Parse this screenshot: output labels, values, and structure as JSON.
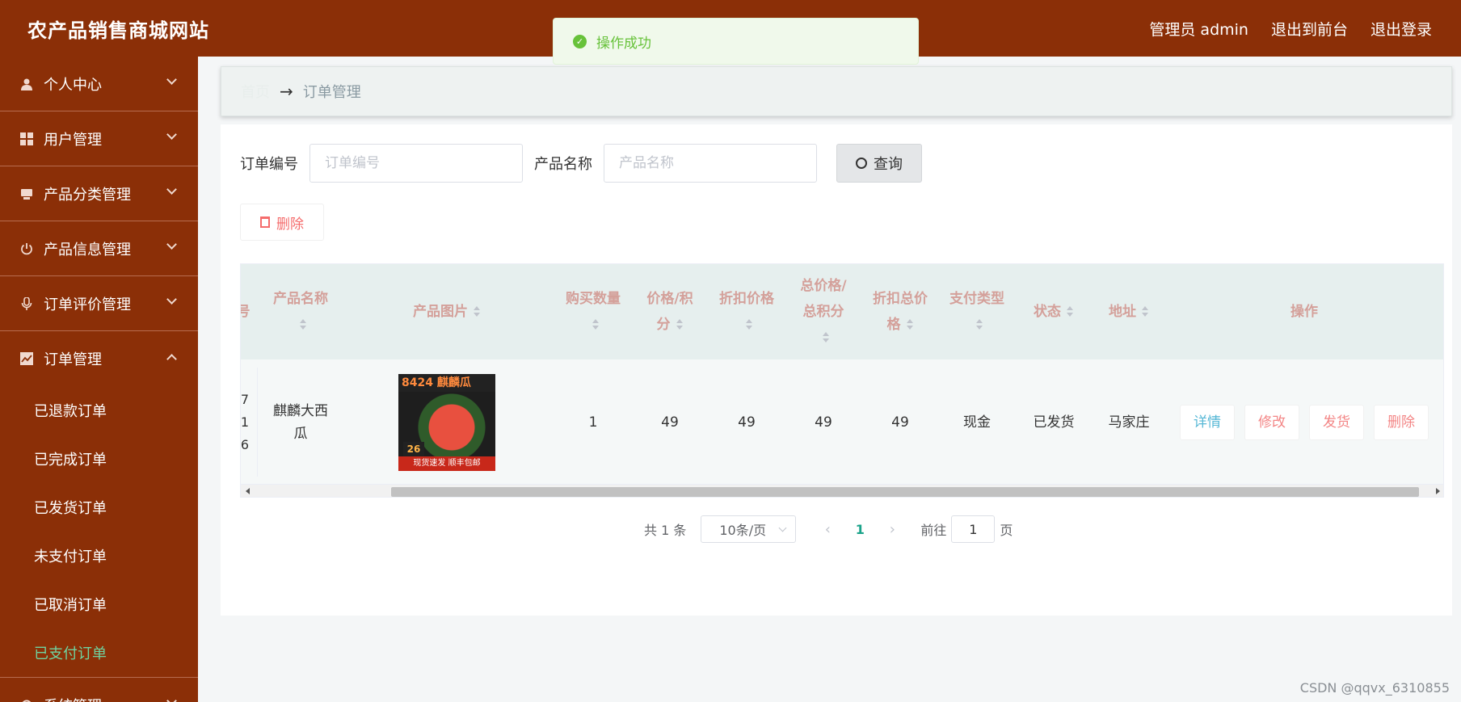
{
  "header": {
    "brand": "农产品销售商城网站",
    "admin_label": "管理员 admin",
    "front_label": "退出到前台",
    "logout_label": "退出登录"
  },
  "toast": {
    "message": "操作成功"
  },
  "sidebar": {
    "items": [
      {
        "label": "个人中心",
        "icon": "user-icon"
      },
      {
        "label": "用户管理",
        "icon": "grid-icon"
      },
      {
        "label": "产品分类管理",
        "icon": "box-icon"
      },
      {
        "label": "产品信息管理",
        "icon": "power-icon"
      },
      {
        "label": "订单评价管理",
        "icon": "microphone-icon"
      },
      {
        "label": "订单管理",
        "icon": "chart-icon"
      }
    ],
    "submenu": [
      {
        "label": "已退款订单"
      },
      {
        "label": "已完成订单"
      },
      {
        "label": "已发货订单"
      },
      {
        "label": "未支付订单"
      },
      {
        "label": "已取消订单"
      },
      {
        "label": "已支付订单"
      }
    ],
    "last": {
      "label": "系统管理",
      "icon": "gear-icon"
    }
  },
  "breadcrumb": {
    "home": "首页",
    "current": "订单管理"
  },
  "search": {
    "order_no_label": "订单编号",
    "order_no_placeholder": "订单编号",
    "product_label": "产品名称",
    "product_placeholder": "产品名称",
    "search_button": "查询"
  },
  "actions": {
    "delete_button": "删除"
  },
  "table": {
    "columns": {
      "product_name": "产品名称",
      "product_image": "产品图片",
      "qty": "购买数量",
      "price_a": "价格/积",
      "price_b": "分",
      "discount_a": "折扣价格",
      "total_a": "总价格/",
      "total_b": "总积分",
      "discount_total_a": "折扣总价",
      "discount_total_b": "格",
      "pay_type": "支付类型",
      "status": "状态",
      "address": "地址",
      "ops": "操作"
    },
    "row": {
      "order_no_frag_1": "7",
      "order_no_frag_2": "1",
      "order_no_frag_3": "6",
      "product_name_1": "麒麟大西",
      "product_name_2": "瓜",
      "image_title": "8424 麒麟瓜",
      "image_price": "26",
      "image_footer": "现货速发 顺丰包邮",
      "qty": "1",
      "price": "49",
      "discount_price": "49",
      "total": "49",
      "discount_total": "49",
      "pay_type": "现金",
      "status": "已发货",
      "address": "马家庄",
      "op_detail": "详情",
      "op_edit": "修改",
      "op_ship": "发货",
      "op_delete": "删除"
    }
  },
  "pagination": {
    "total": "共 1 条",
    "page_size": "10条/页",
    "current_page": "1",
    "goto_label": "前往",
    "goto_value": "1",
    "page_unit": "页"
  },
  "watermark": "CSDN @qqvx_6310855",
  "colors": {
    "header_bg": "#8b2f07",
    "sidebar_bg": "#8b2f07",
    "active_sub": "#6fd3a0",
    "success": "#67c23a",
    "danger": "#f56c6c",
    "info": "#57b8d6"
  }
}
